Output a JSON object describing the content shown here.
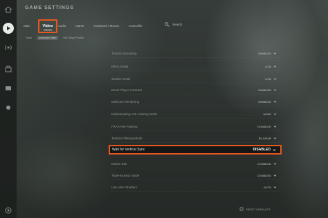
{
  "window": {
    "title": "GAME SETTINGS"
  },
  "nav": {
    "tabs": [
      {
        "label": "Main"
      },
      {
        "label": "Audio"
      },
      {
        "label": "Game"
      },
      {
        "label": "Keyboard / Mouse"
      },
      {
        "label": "Controller"
      }
    ],
    "active_tab": "Video",
    "search_label": "Search"
  },
  "subnav": {
    "items": [
      "Video",
      "Advanced Video",
      "HUD Edge Position"
    ],
    "active_index": 1
  },
  "settings": [
    {
      "label": "Texture Streaming",
      "value": "ENABLED"
    },
    {
      "label": "Effect Detail",
      "value": "LOW"
    },
    {
      "label": "Shader Detail",
      "value": "LOW"
    },
    {
      "label": "Boost Player Contrast",
      "value": "ENABLED"
    },
    {
      "label": "Multicore Rendering",
      "value": "ENABLED"
    },
    {
      "label": "Multisampling Anti-Aliasing Mode",
      "value": "NONE"
    },
    {
      "label": "FXAA Anti-Aliasing",
      "value": "DISABLED"
    },
    {
      "label": "Texture Filtering Mode",
      "value": "BILINEAR"
    },
    {
      "label": "Wait for Vertical Sync",
      "value": "DISABLED"
    },
    {
      "label": "Motion Blur",
      "value": "DISABLED"
    },
    {
      "label": "Triple-Monitor Mode",
      "value": "DISABLED"
    },
    {
      "label": "Use Uber Shaders",
      "value": "AUTO"
    }
  ],
  "highlighted_index": 8,
  "footer": {
    "reset_label": "RESET DEFAULTS"
  },
  "colors": {
    "highlight": "#e8571f",
    "panel_bg": "#2e3431"
  },
  "icons": [
    "home-icon",
    "play-icon",
    "antenna-icon",
    "inventory-icon",
    "tv-icon",
    "settings-icon",
    "search-icon",
    "chevron-down-icon",
    "reset-icon"
  ]
}
